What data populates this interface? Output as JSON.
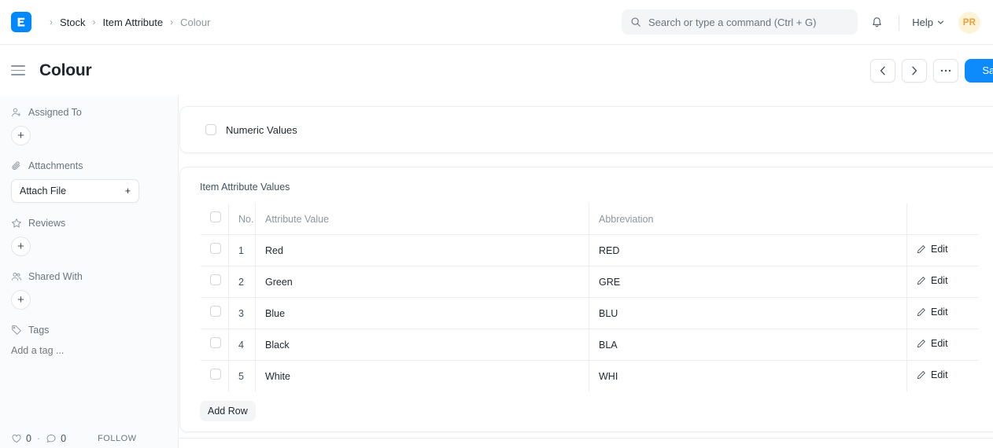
{
  "navbar": {
    "logo_alt": "frappe-logo",
    "breadcrumb": [
      {
        "label": "Stock",
        "muted": false
      },
      {
        "label": "Item Attribute",
        "muted": false
      },
      {
        "label": "Colour",
        "muted": true
      }
    ],
    "separator": "›",
    "search": {
      "placeholder": "Search or type a command (Ctrl + G)",
      "value": ""
    },
    "notifications_label": "Notifications",
    "help_label": "Help",
    "avatar_initials": "PR"
  },
  "page": {
    "title": "Colour",
    "actions": {
      "prev": "‹",
      "next": "›",
      "more": "···",
      "save_label": "Save"
    }
  },
  "sidebar": {
    "assigned_to": {
      "label": "Assigned To",
      "add": "+"
    },
    "attachments": {
      "label": "Attachments",
      "button_label": "Attach File",
      "button_icon": "+"
    },
    "reviews": {
      "label": "Reviews",
      "add": "+"
    },
    "shared_with": {
      "label": "Shared With",
      "add": "+"
    },
    "tags": {
      "label": "Tags",
      "placeholder": "Add a tag ...",
      "value": ""
    },
    "footer": {
      "likes": "0",
      "separator": "·",
      "comments": "0",
      "follow_label": "FOLLOW"
    }
  },
  "main": {
    "numeric_values_label": "Numeric Values",
    "numeric_values_checked": false,
    "grid_title": "Item Attribute Values",
    "columns": {
      "no": "No.",
      "attribute_value": "Attribute Value",
      "abbreviation": "Abbreviation",
      "action": ""
    },
    "rows": [
      {
        "no": "1",
        "attribute_value": "Red",
        "abbreviation": "RED",
        "edit_label": "Edit"
      },
      {
        "no": "2",
        "attribute_value": "Green",
        "abbreviation": "GRE",
        "edit_label": "Edit"
      },
      {
        "no": "3",
        "attribute_value": "Blue",
        "abbreviation": "BLU",
        "edit_label": "Edit"
      },
      {
        "no": "4",
        "attribute_value": "Black",
        "abbreviation": "BLA",
        "edit_label": "Edit"
      },
      {
        "no": "5",
        "attribute_value": "White",
        "abbreviation": "WHI",
        "edit_label": "Edit"
      }
    ],
    "add_row_label": "Add Row"
  },
  "colors": {
    "brand_blue": "#0089ff",
    "save_blue": "#0d8bfc",
    "avatar_bg": "#fdf3d7",
    "avatar_fg": "#e8a33d",
    "border": "#ebeef0",
    "sidebar_bg": "#fafbfc",
    "muted_text": "#8d97a0"
  }
}
